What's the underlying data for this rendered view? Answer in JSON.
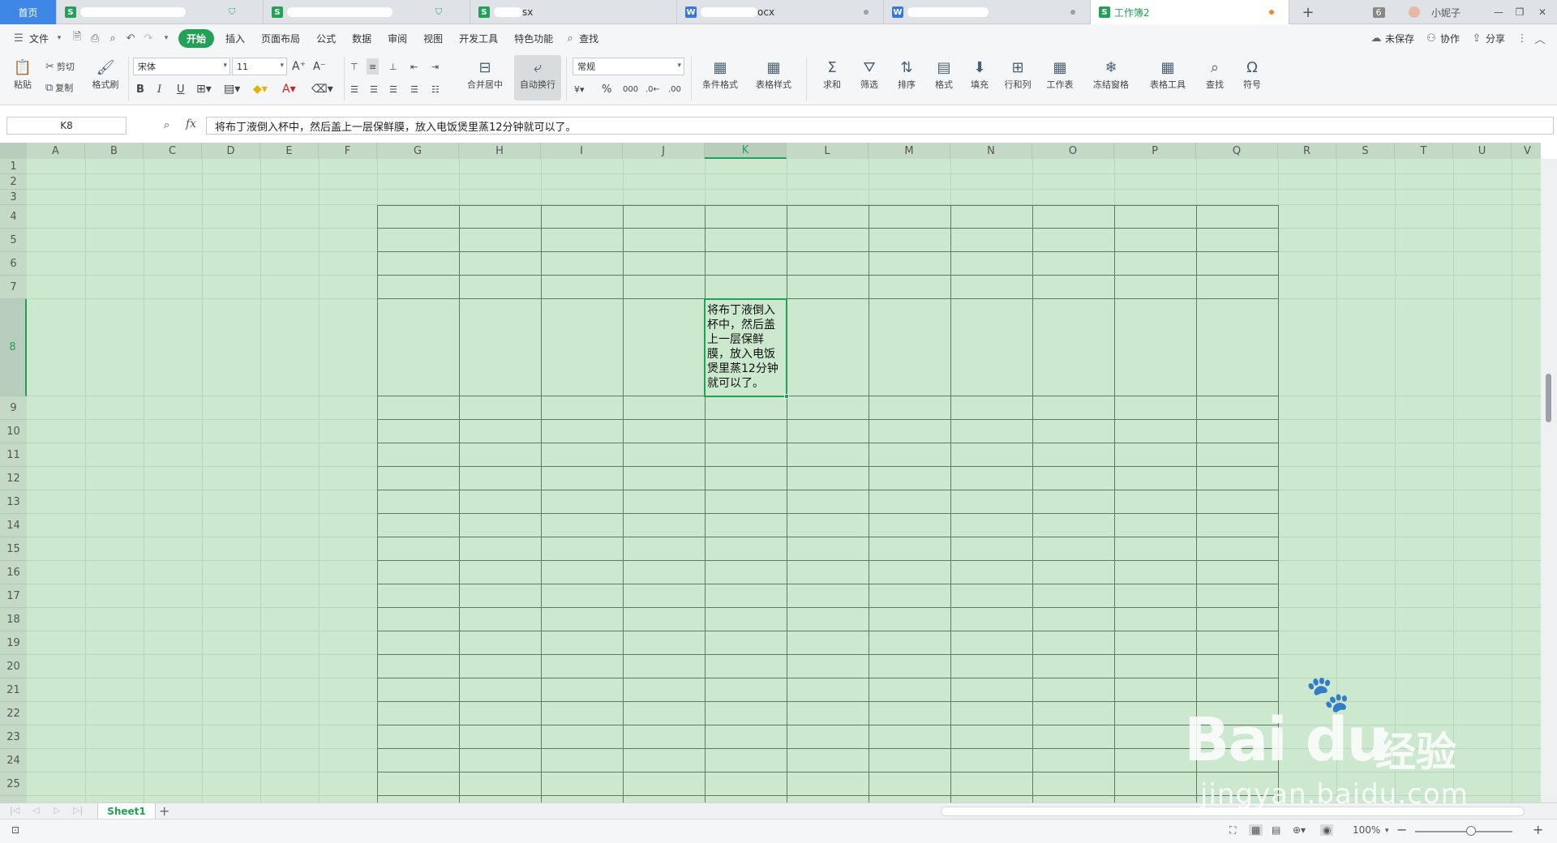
{
  "tabs": {
    "home": "首页",
    "doc3": "sx",
    "doc4": "ocx",
    "active": "工作簿2",
    "count": "6",
    "user": "小妮子"
  },
  "menu": {
    "file": "文件",
    "items": [
      "开始",
      "插入",
      "页面布局",
      "公式",
      "数据",
      "审阅",
      "视图",
      "开发工具",
      "特色功能"
    ],
    "search": "查找",
    "unsaved": "未保存",
    "collab": "协作",
    "share": "分享"
  },
  "ribbon": {
    "paste": "粘贴",
    "cut": "剪切",
    "copy": "复制",
    "format_painter": "格式刷",
    "font_name": "宋体",
    "font_size": "11",
    "merge": "合并居中",
    "wrap": "自动换行",
    "number_format": "常规",
    "cond_format": "条件格式",
    "table_style": "表格样式",
    "sum": "求和",
    "filter": "筛选",
    "sort": "排序",
    "format": "格式",
    "fill": "填充",
    "rowcol": "行和列",
    "worksheet": "工作表",
    "freeze": "冻结窗格",
    "table_tools": "表格工具",
    "find": "查找",
    "symbol": "符号"
  },
  "formula_bar": {
    "cell_ref": "K8",
    "fx": "fx",
    "content": "将布丁液倒入杯中，然后盖上一层保鲜膜，放入电饭煲里蒸12分钟就可以了。"
  },
  "columns": [
    "A",
    "B",
    "C",
    "D",
    "E",
    "F",
    "G",
    "H",
    "I",
    "J",
    "K",
    "L",
    "M",
    "N",
    "O",
    "P",
    "Q",
    "R",
    "S",
    "T",
    "U",
    "V"
  ],
  "rows": [
    "1",
    "2",
    "3",
    "4",
    "5",
    "6",
    "7",
    "8",
    "9",
    "10",
    "11",
    "12",
    "13",
    "14",
    "15",
    "16",
    "17",
    "18",
    "19",
    "20",
    "21",
    "22",
    "23",
    "24",
    "25"
  ],
  "active_cell": {
    "ref": "K8",
    "text": "将布丁液倒入杯中，然后盖上一层保鲜膜，放入电饭煲里蒸12分钟就可以了。"
  },
  "sheets": [
    "Sheet1"
  ],
  "status": {
    "zoom": "100%"
  },
  "watermark": {
    "logo": "Bai du",
    "cn": "经验",
    "url": "jingyan.baidu.com"
  },
  "colors": {
    "accent": "#23a257",
    "grid_bg": "#cce8cf",
    "home_tab": "#3f87e6"
  }
}
